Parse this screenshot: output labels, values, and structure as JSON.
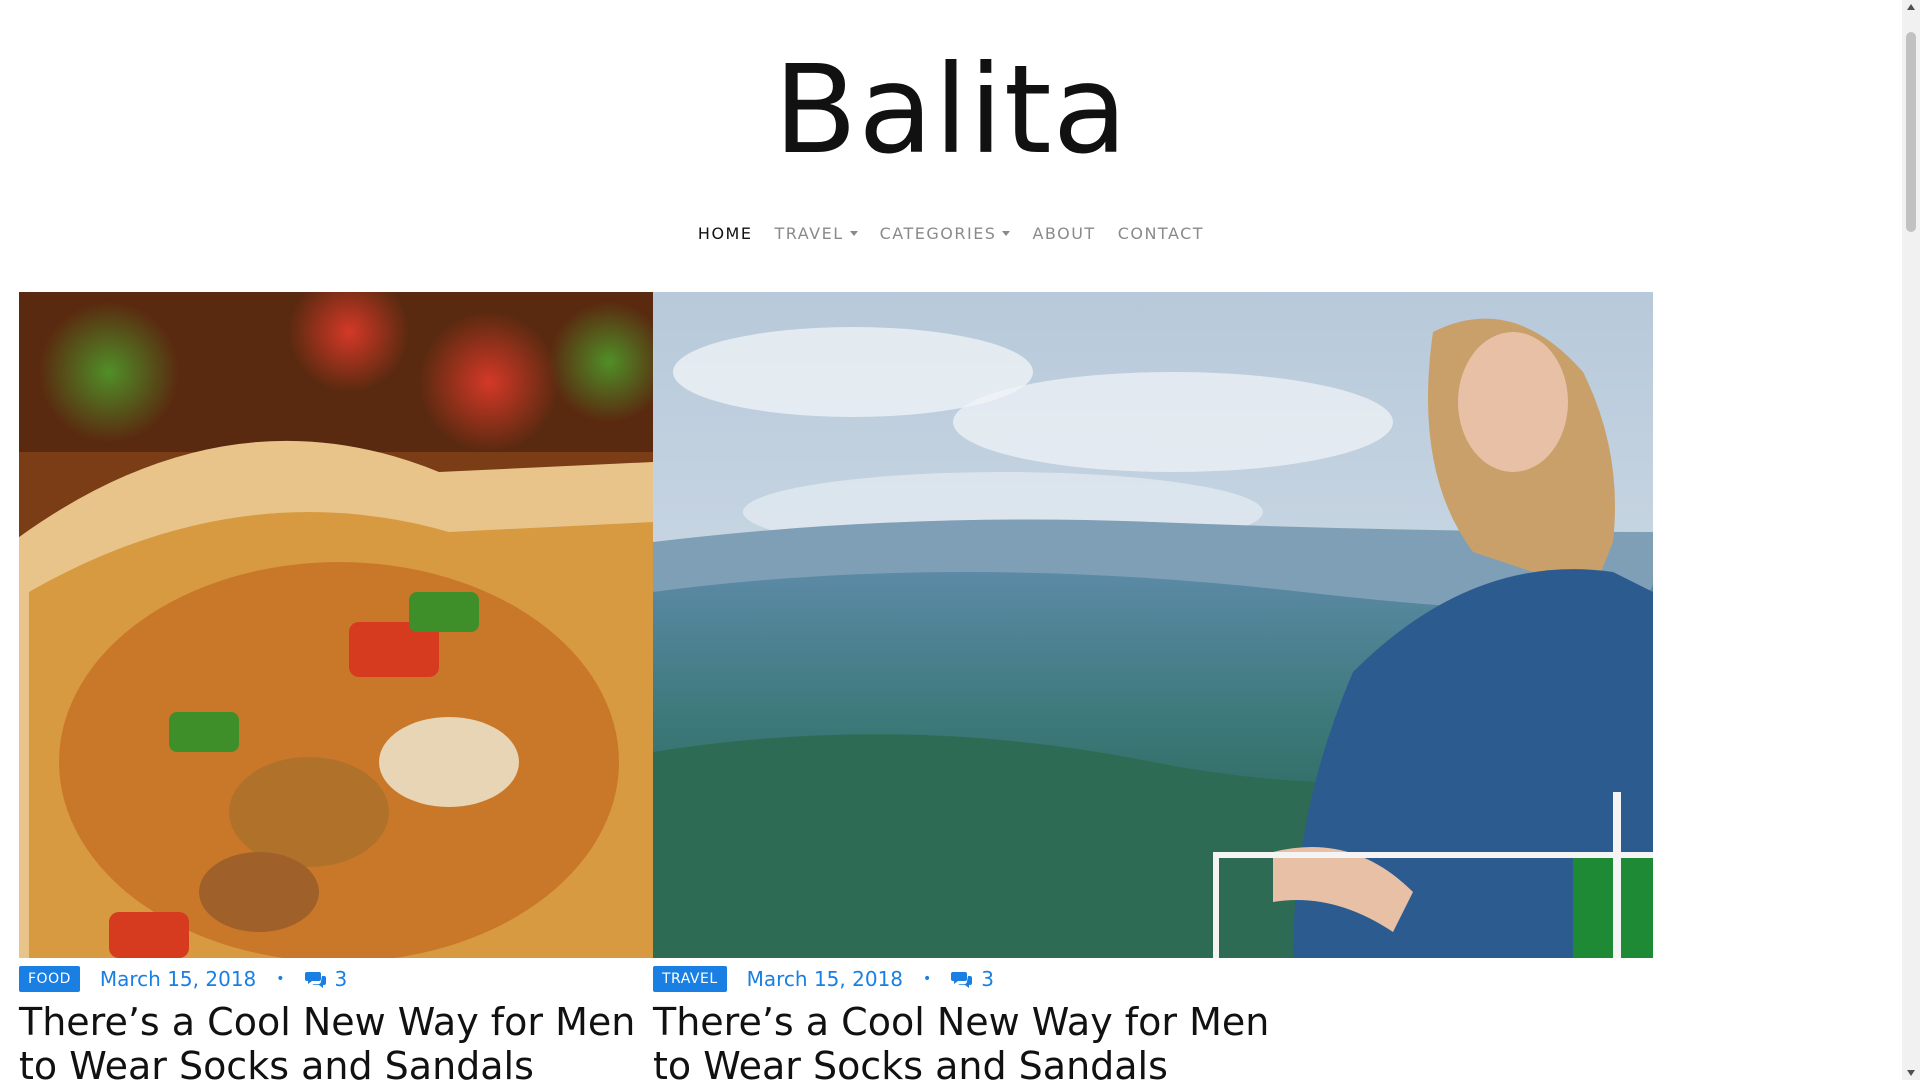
{
  "site": {
    "brand": "Balita"
  },
  "nav": {
    "items": [
      {
        "label": "HOME",
        "active": true
      },
      {
        "label": "TRAVEL",
        "dropdown": true
      },
      {
        "label": "CATEGORIES",
        "dropdown": true
      },
      {
        "label": "ABOUT"
      },
      {
        "label": "CONTACT"
      }
    ]
  },
  "posts": [
    {
      "category": "FOOD",
      "date": "March 15, 2018",
      "comments": "3",
      "title": "There’s a Cool New Way for Men to Wear Socks and Sandals",
      "image": "food-burrito-image"
    },
    {
      "category": "TRAVEL",
      "date": "March 15, 2018",
      "comments": "3",
      "title": "There’s a Cool New Way for Men to Wear Socks and Sandals",
      "image": "travel-mountain-woman-image"
    }
  ],
  "icons": {
    "comments": "comments-icon",
    "dropdown": "caret-down-icon"
  },
  "colors": {
    "accent": "#1a7fe3",
    "nav_inactive": "#8a8a8a",
    "nav_active": "#111111"
  }
}
